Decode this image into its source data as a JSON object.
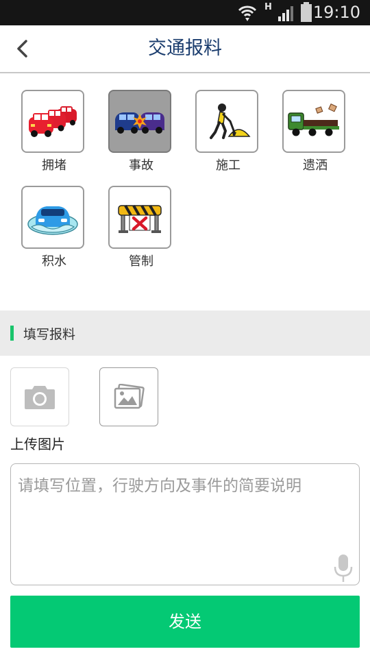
{
  "status_bar": {
    "time": "19:10",
    "network": "H"
  },
  "header": {
    "title": "交通报料",
    "back_icon": "chevron-left-icon"
  },
  "categories": [
    {
      "label": "拥堵",
      "icon": "traffic-jam-icon",
      "selected": false
    },
    {
      "label": "事故",
      "icon": "car-accident-icon",
      "selected": true
    },
    {
      "label": "施工",
      "icon": "construction-worker-icon",
      "selected": false
    },
    {
      "label": "遗洒",
      "icon": "spill-truck-icon",
      "selected": false
    },
    {
      "label": "积水",
      "icon": "flooded-car-icon",
      "selected": false
    },
    {
      "label": "管制",
      "icon": "road-barrier-icon",
      "selected": false
    }
  ],
  "section": {
    "title": "填写报料"
  },
  "upload": {
    "label": "上传图片",
    "camera_icon": "camera-icon",
    "gallery_icon": "gallery-icon"
  },
  "description": {
    "placeholder": "请填写位置，行驶方向及事件的简要说明",
    "value": ""
  },
  "send_button": {
    "label": "发送"
  },
  "colors": {
    "accent": "#04c974",
    "title": "#1b3d6e",
    "selected_bg": "#9e9e9e"
  }
}
